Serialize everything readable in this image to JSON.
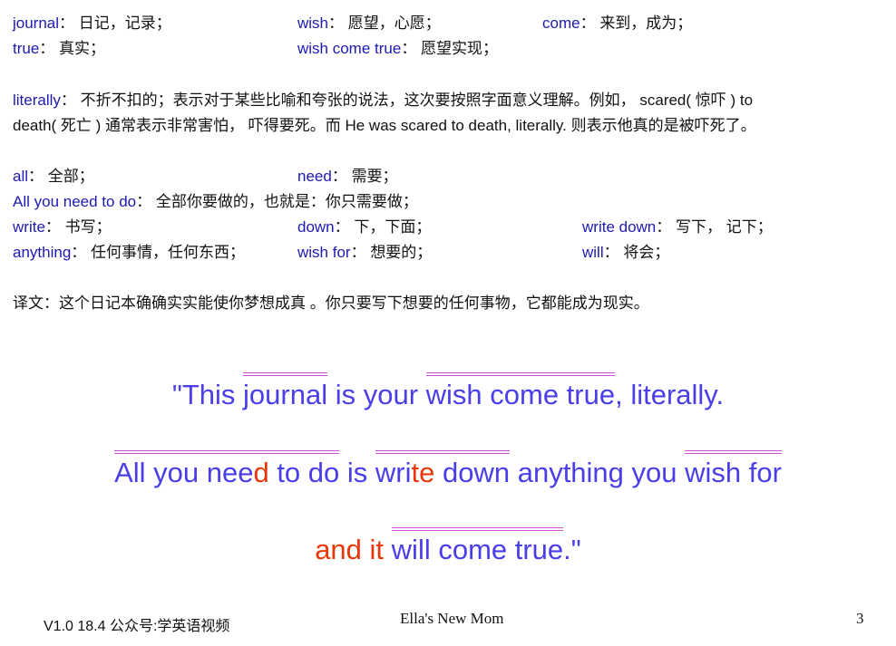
{
  "vocab_row1": [
    {
      "term": "journal",
      "gloss": "日记，记录；"
    },
    {
      "term": "wish",
      "gloss": "愿望，心愿；"
    },
    {
      "term": "come",
      "gloss": "来到，成为；"
    }
  ],
  "vocab_row2": [
    {
      "term": "true",
      "gloss": "真实；"
    },
    {
      "term": "wish come true",
      "gloss": "愿望实现；"
    }
  ],
  "literally": {
    "term": "literally",
    "gloss_line1": "不折不扣的；表示对于某些比喻和夸张的说法，这次要按照字面意义理解。例如， scared( 惊吓 ) to",
    "gloss_line2": "death( 死亡 ) 通常表示非常害怕， 吓得要死。而 He was scared to death, literally. 则表示他真的是被吓死了。"
  },
  "vocab_row3": [
    {
      "term": "all",
      "gloss": "全部；"
    },
    {
      "term": "need",
      "gloss": "需要；"
    }
  ],
  "vocab_row4": {
    "term": "All you need to do",
    "gloss": "全部你要做的，也就是：你只需要做；"
  },
  "vocab_row5": [
    {
      "term": "write",
      "gloss": "书写；"
    },
    {
      "term": "down",
      "gloss": "下，下面；"
    },
    {
      "term": "write down",
      "gloss": "写下， 记下；"
    }
  ],
  "vocab_row6": [
    {
      "term": "anything",
      "gloss": "任何事情，任何东西；"
    },
    {
      "term": "wish for",
      "gloss": "想要的；"
    },
    {
      "term": "will",
      "gloss": "将会；"
    }
  ],
  "translation": "译文：这个日记本确确实实能使你梦想成真 。你只要写下想要的任何事物，它都能成为现实。",
  "quote": {
    "l1": {
      "a": "\"This ",
      "b": "journal",
      "c": " is your ",
      "d": "wish come true",
      "e": ", literally."
    },
    "l2": {
      "a": "All you nee",
      "b": "d",
      "c": " to do",
      "d": " is ",
      "e": "wri",
      "f": "te",
      "g": " down",
      "h": " anything you ",
      "i": "wish for"
    },
    "l3": {
      "a": "and",
      "b": " ",
      "c": "it",
      "d": " ",
      "e": "will come true",
      "f": ".\""
    }
  },
  "footer": {
    "version": "V1.0 18.4 公众号:学英语视频",
    "title": "Ella's New Mom",
    "page": "3"
  },
  "colors": {
    "term": "#1d1ab0",
    "quote": "#4a3ee8",
    "highlight": "#e8380a",
    "underline": "#d44bd0"
  }
}
